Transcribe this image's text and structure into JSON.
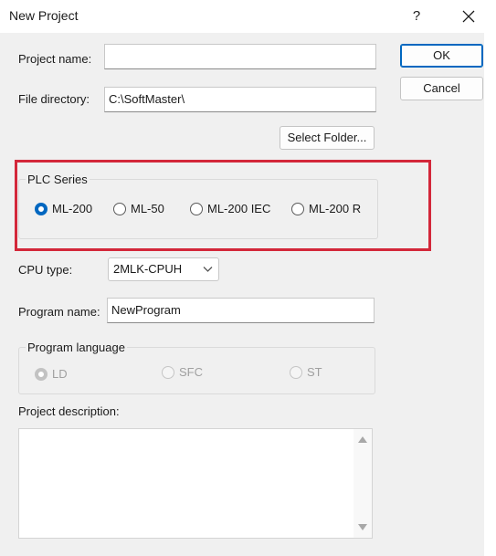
{
  "window": {
    "title": "New Project",
    "help_label": "?"
  },
  "form": {
    "project_name_label": "Project name:",
    "project_name_value": "",
    "file_directory_label": "File directory:",
    "file_directory_value": "C:\\SoftMaster\\",
    "select_folder_label": "Select Folder...",
    "plc_series": {
      "title": "PLC Series",
      "options": [
        "ML-200",
        "ML-50",
        "ML-200 IEC",
        "ML-200 R"
      ],
      "selected": "ML-200"
    },
    "cpu_type_label": "CPU type:",
    "cpu_type_value": "2MLK-CPUH",
    "program_name_label": "Program name:",
    "program_name_value": "NewProgram",
    "program_language": {
      "title": "Program language",
      "options": [
        "LD",
        "SFC",
        "ST"
      ],
      "selected": "LD",
      "enabled": false
    },
    "project_description_label": "Project description:",
    "project_description_value": ""
  },
  "buttons": {
    "ok_label": "OK",
    "cancel_label": "Cancel"
  },
  "colors": {
    "accent": "#0067c0",
    "highlight": "#d3273a",
    "dialog_bg": "#f0f0f0"
  },
  "icons": [
    "close-icon",
    "chevron-down-icon",
    "scroll-up-icon",
    "scroll-down-icon"
  ]
}
